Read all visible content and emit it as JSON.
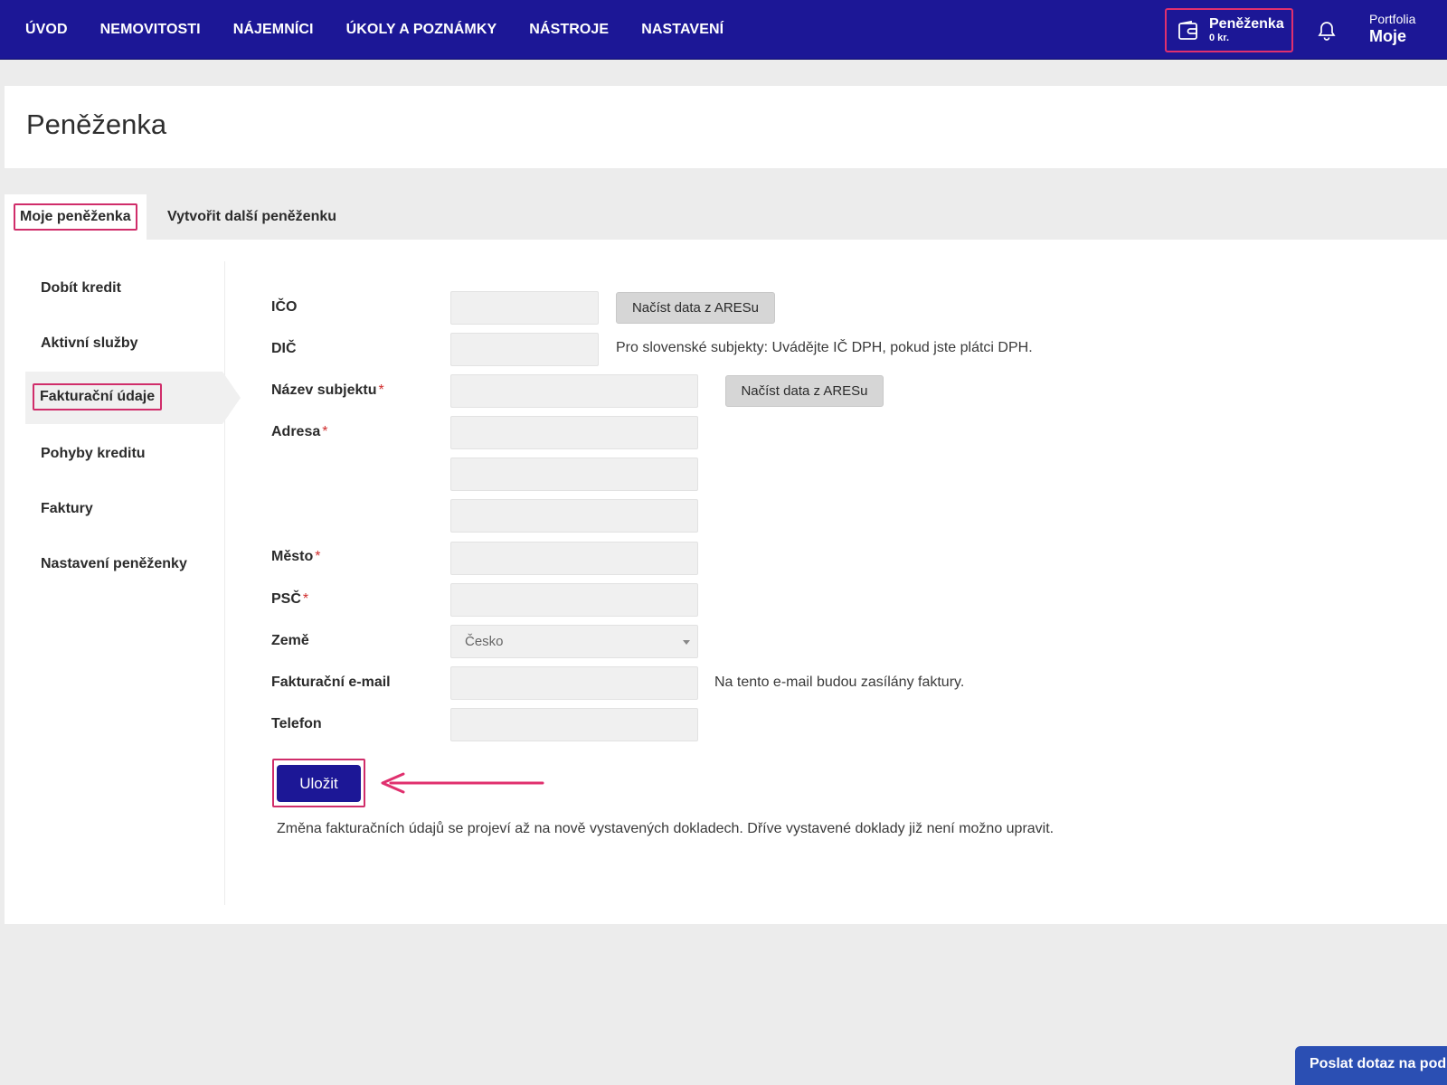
{
  "nav": {
    "items": [
      "ÚVOD",
      "NEMOVITOSTI",
      "NÁJEMNÍCI",
      "ÚKOLY A POZNÁMKY",
      "NÁSTROJE",
      "NASTAVENÍ"
    ],
    "wallet": {
      "title": "Peněženka",
      "amount": "0 kr."
    },
    "portfolio": {
      "label": "Portfolia",
      "value": "Moje"
    }
  },
  "page": {
    "title": "Peněženka"
  },
  "tabs": {
    "active": "Moje peněženka",
    "other": "Vytvořit další peněženku"
  },
  "sidebar": {
    "items": [
      "Dobít kredit",
      "Aktivní služby",
      "Fakturační údaje",
      "Pohyby kreditu",
      "Faktury",
      "Nastavení peněženky"
    ],
    "active_index": 2
  },
  "form": {
    "ico_label": "IČO",
    "dic_label": "DIČ",
    "name_label": "Název subjektu",
    "address_label": "Adresa",
    "city_label": "Město",
    "zip_label": "PSČ",
    "country_label": "Země",
    "email_label": "Fakturační e-mail",
    "phone_label": "Telefon",
    "required_mark": "*",
    "ares_button": "Načíst data z ARESu",
    "dic_hint": "Pro slovenské subjekty: Uvádějte IČ DPH, pokud jste plátci DPH.",
    "email_hint": "Na tento e-mail budou zasílány faktury.",
    "country_value": "Česko",
    "save_button": "Uložit",
    "note": "Změna fakturačních údajů se projeví až na nově vystavených dokladech. Dříve vystavené doklady již není možno upravit."
  },
  "support": {
    "label": "Poslat dotaz na podp"
  },
  "colors": {
    "nav_bg": "#1c1796",
    "highlight": "#d02d6a",
    "support_bg": "#2b4fb3"
  },
  "icons": {
    "wallet": "wallet-icon",
    "bell": "bell-icon",
    "arrow": "arrow-left-annotation"
  }
}
